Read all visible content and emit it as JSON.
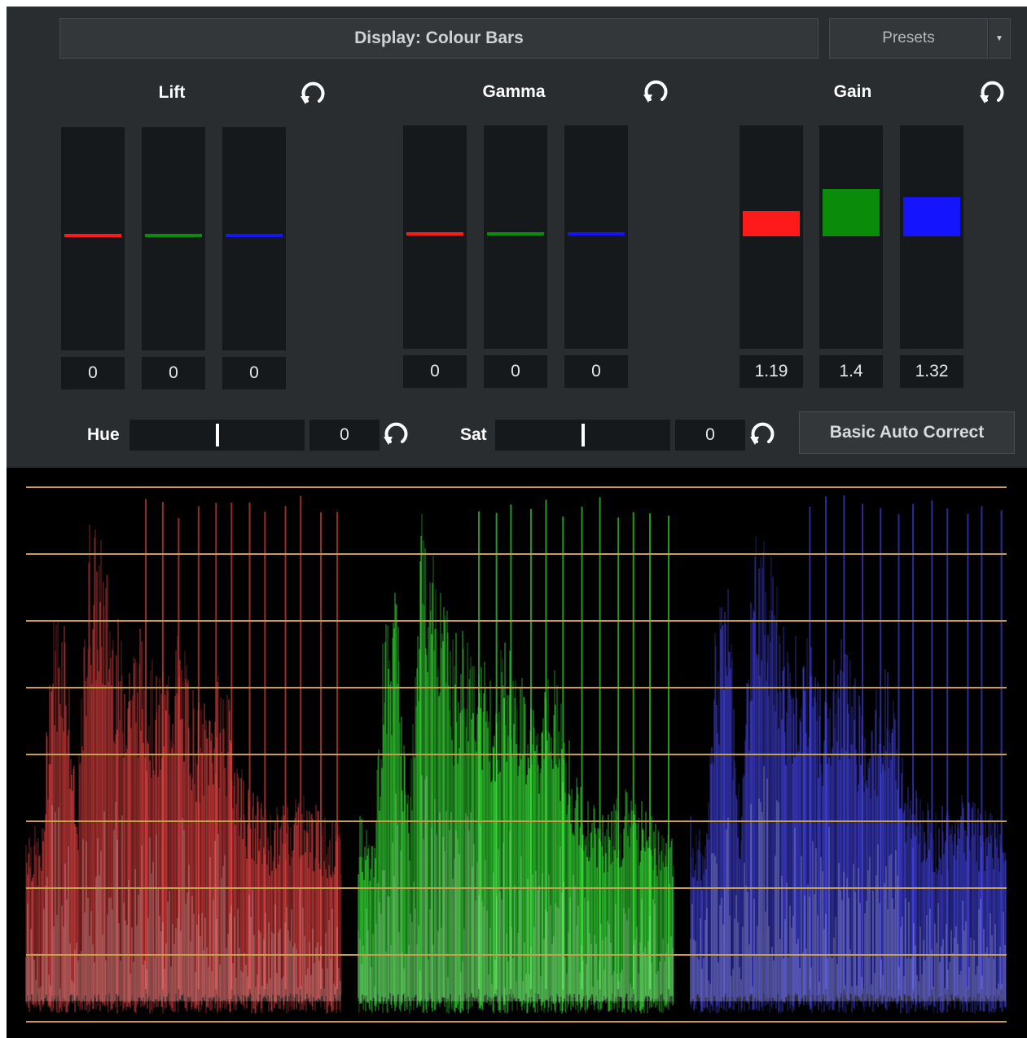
{
  "header": {
    "display_label": "Display: Colour Bars",
    "presets_label": "Presets",
    "presets_arrow": "▼"
  },
  "groups": [
    {
      "title": "Lift",
      "values": [
        "0",
        "0",
        "0"
      ],
      "levels": [
        0.5,
        0.5,
        0.5
      ]
    },
    {
      "title": "Gamma",
      "values": [
        "0",
        "0",
        "0"
      ],
      "levels": [
        0.5,
        0.5,
        0.5
      ]
    },
    {
      "title": "Gain",
      "values": [
        "1.19",
        "1.4",
        "1.32"
      ],
      "levels": [
        1.19,
        1.4,
        1.32
      ]
    }
  ],
  "channel_colors": [
    "#ff1a1a",
    "#0a8c0a",
    "#1414ff"
  ],
  "hue": {
    "label": "Hue",
    "value": "0",
    "level": 0.5
  },
  "sat": {
    "label": "Sat",
    "value": "0",
    "level": 0.5
  },
  "auto_correct_label": "Basic Auto Correct",
  "icons": {
    "reset": "reset-rotate-icon"
  },
  "waveform": {
    "graticule_color": "#c8a04a",
    "parade_colors": [
      "#ff4a4a",
      "#3cff3c",
      "#4a4aff"
    ]
  }
}
